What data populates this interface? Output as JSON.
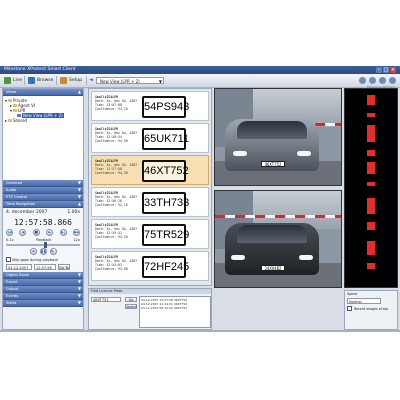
{
  "window": {
    "title": "Milestone XProtect Smart Client"
  },
  "toolbar": {
    "tabs": [
      {
        "label": "Live",
        "color": "#4a9a3f"
      },
      {
        "label": "Browse",
        "color": "#3b6ec0"
      },
      {
        "label": "Setup",
        "color": "#d08a1f"
      }
    ],
    "view_select": "New View (LPR + 2)",
    "brand": "Milestone XProtect"
  },
  "left": {
    "views_header": "Views",
    "tree": [
      {
        "label": "Private",
        "depth": 0,
        "kind": "folder"
      },
      {
        "label": "Agent VI",
        "depth": 1,
        "kind": "folder"
      },
      {
        "label": "LPR",
        "depth": 1,
        "kind": "folder"
      },
      {
        "label": "New View (LPR + 2)",
        "depth": 2,
        "kind": "camera",
        "selected": true
      },
      {
        "label": "Shared",
        "depth": 0,
        "kind": "folder"
      }
    ],
    "sections": [
      "Cameras",
      "Audio",
      "PTZ Control"
    ],
    "playback_header": "Time Navigation",
    "date": "4. december 2007",
    "speed": "1.00x",
    "time": "12:57:58.866",
    "speed_min": "0.1x",
    "speed_max": "12x",
    "speed_label": "Playback",
    "skip_label": "Skip gaps during playback",
    "goto_date": "04-12-2007",
    "goto_time": "12:57:58",
    "goto_label": "Go To",
    "footer_sections": [
      "Digital Zoom",
      "Export",
      "Output",
      "Events",
      "Alerts"
    ]
  },
  "plates": [
    {
      "header": "SmallyIS4LPR",
      "date": "Date: to, dec 04, 2007",
      "time": "Time: 13:07:08",
      "conf": "Confidence: 93,20",
      "plate": "54PS943",
      "selected": false
    },
    {
      "header": "SmallyIS4LPR",
      "date": "Date: to, dec 04, 2007",
      "time": "Time: 12:58:44",
      "conf": "Confidence: 94,90",
      "plate": "65UK711",
      "selected": false
    },
    {
      "header": "SmallyIS4LPR",
      "date": "Date: to, dec 04, 2007",
      "time": "Time: 12:57:58",
      "conf": "Confidence: 94,30",
      "plate": "46XT752",
      "selected": true
    },
    {
      "header": "SmallyIS4LPR",
      "date": "Date: to, dec 04, 2007",
      "time": "Time: 12:56:16",
      "conf": "Confidence: 92,10",
      "plate": "33TH733",
      "selected": false
    },
    {
      "header": "SmallyIS4LPR",
      "date": "Date: to, dec 04, 2007",
      "time": "Time: 12:55:41",
      "conf": "Confidence: 95,20",
      "plate": "75TR529",
      "selected": false
    },
    {
      "header": "SmallyIS4LPR",
      "date": "Date: to, dec 04, 2007",
      "time": "Time: 12:54:03",
      "conf": "Confidence: 93,80",
      "plate": "72HF245",
      "selected": false
    }
  ],
  "detail": {
    "header": "Find License Plate",
    "plate_value": "46XT752",
    "go_label": "Go",
    "search_label": "Search",
    "log": [
      "04-12-2007 12:57:58  46XT752",
      "04-12-2007 12:44:31  46XT752",
      "03-12-2007 08:12:05  46XT752"
    ]
  },
  "cameras": [
    {
      "plate": "46XT752"
    },
    {
      "plate": "24XV482"
    }
  ],
  "strip_segments": [
    {
      "top": 0.03,
      "h": 0.05
    },
    {
      "top": 0.12,
      "h": 0.02
    },
    {
      "top": 0.18,
      "h": 0.09
    },
    {
      "top": 0.31,
      "h": 0.03
    },
    {
      "top": 0.37,
      "h": 0.06
    },
    {
      "top": 0.47,
      "h": 0.02
    },
    {
      "top": 0.55,
      "h": 0.08
    },
    {
      "top": 0.67,
      "h": 0.04
    },
    {
      "top": 0.77,
      "h": 0.07
    },
    {
      "top": 0.88,
      "h": 0.03
    }
  ],
  "right_bottom": {
    "speed_label": "Speed",
    "speed_value": "Normal",
    "record_label": "Record images at top"
  }
}
